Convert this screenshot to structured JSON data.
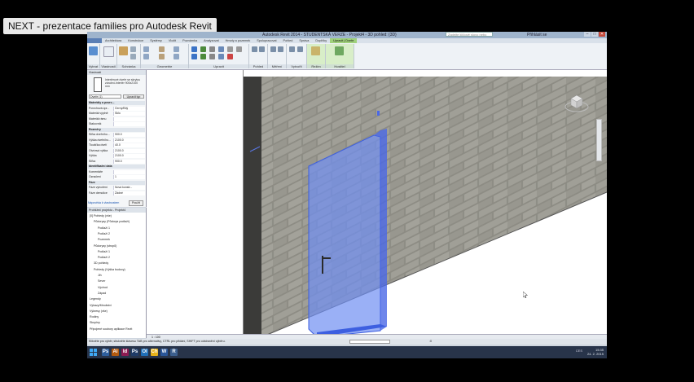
{
  "video_title": "NEXT - prezentace families pro Autodesk Revit",
  "window": {
    "app_title": "Autodesk Revit 2014 - STUDENTSKÁ VERZE - Projekt4 - 3D pohled: {3D}",
    "search_placeholder": "Zadejte klíčové slovo nebo frázi",
    "login": "Přihlásit se",
    "controls": [
      "–",
      "□",
      "✕"
    ]
  },
  "ribbon": {
    "tabs": [
      "Architektura",
      "Konstrukce",
      "Systémy",
      "Vložit",
      "Poznámka",
      "Analyzovat",
      "Hmoty a pozemek",
      "Spolupracovat",
      "Pohled",
      "Správa",
      "Doplňky",
      "Upravit | Dveře"
    ],
    "active_tab": "Upravit | Dveře",
    "panels": [
      "Vybrat",
      "Vlastnosti",
      "Schránka",
      "Geometrie",
      "Upravit",
      "Pohled",
      "Měření",
      "Vytvořit",
      "Režim",
      "Hostitel"
    ],
    "buttons": {
      "modify": "Upravit",
      "flip": "Upravit rodinu",
      "pick_host": "Vybrat novou hostitele"
    }
  },
  "properties": {
    "title": "Vlastnosti",
    "type_name": "Interiérové dveře se skrytou zárubní-Interiér 900x2100 mm",
    "selector": "Dveře (1)",
    "edit_type": "Upravit typ",
    "rows": [
      {
        "k": "Materiály a povrc...",
        "v": "",
        "group": true
      },
      {
        "k": "Povrchová úpr...",
        "v": "Černý/Bílý",
        "group": false
      },
      {
        "k": "Materiál výplně",
        "v": "Sklo",
        "group": false
      },
      {
        "k": "Materiál rámu",
        "v": "",
        "group": false
      },
      {
        "k": "Stakovník",
        "v": "",
        "group": false
      },
      {
        "k": "Rozměry",
        "v": "",
        "group": true
      },
      {
        "k": "Šířka dveřního...",
        "v": "900.0",
        "group": false
      },
      {
        "k": "Výška dveřního...",
        "v": "2100.0",
        "group": false
      },
      {
        "k": "Tloušťka dveří",
        "v": "40.0",
        "group": false
      },
      {
        "k": "Otvíravá výška",
        "v": "2100.0",
        "group": false
      },
      {
        "k": "Výška",
        "v": "2100.0",
        "group": false
      },
      {
        "k": "Šířka",
        "v": "900.0",
        "group": false
      },
      {
        "k": "Identifikační data",
        "v": "",
        "group": true
      },
      {
        "k": "Komentáře",
        "v": "",
        "group": false
      },
      {
        "k": "Označení",
        "v": "1",
        "group": false
      },
      {
        "k": "Fáze",
        "v": "",
        "group": true
      },
      {
        "k": "Fáze vytvoření",
        "v": "Nová konstr...",
        "group": false
      },
      {
        "k": "Fáze demolice",
        "v": "Žádné",
        "group": false
      }
    ],
    "help_link": "Nápověda k vlastnostem",
    "apply": "Použít"
  },
  "browser": {
    "title": "Prohlížeč projektu - Projekt4",
    "items": [
      {
        "label": "[0] Pohledy (vše)",
        "indent": 0
      },
      {
        "label": "Půdorysy (Půdorys podlaží)",
        "indent": 1
      },
      {
        "label": "Podlaží 1",
        "indent": 2
      },
      {
        "label": "Podlaží 2",
        "indent": 2
      },
      {
        "label": "Pozemek",
        "indent": 2
      },
      {
        "label": "Půdorysy (stropů)",
        "indent": 1
      },
      {
        "label": "Podlaží 1",
        "indent": 2
      },
      {
        "label": "Podlaží 2",
        "indent": 2
      },
      {
        "label": "3D pohledy",
        "indent": 1
      },
      {
        "label": "Pohledy (Výška budovy)",
        "indent": 1
      },
      {
        "label": "Jih",
        "indent": 2
      },
      {
        "label": "Sever",
        "indent": 2
      },
      {
        "label": "Východ",
        "indent": 2
      },
      {
        "label": "Západ",
        "indent": 2
      },
      {
        "label": "Legendy",
        "indent": 0
      },
      {
        "label": "Výkazy/Množství",
        "indent": 0
      },
      {
        "label": "Výkresy (vše)",
        "indent": 0
      },
      {
        "label": "Rodiny",
        "indent": 0
      },
      {
        "label": "Skupiny",
        "indent": 0
      },
      {
        "label": "Připojené soubory aplikace Revit",
        "indent": 0
      }
    ]
  },
  "view_controls": {
    "scale": "1 : 100"
  },
  "status": {
    "hint": "Klikněte pro výběr, stiskněte klávesu TAB pro alternativy, CTRL pro přidání, SHIFT pro odstranění výběru.",
    "count": ":0"
  },
  "taskbar": {
    "apps": [
      "Ps",
      "Ai",
      "Id",
      "Ps",
      "Ol",
      "Ch",
      "W",
      "R"
    ],
    "lang": "CES",
    "time": "15:35",
    "date": "24. 2. 2015"
  },
  "colors": {
    "door_glass": "#6f8ff2",
    "selection_blue": "#4a68e6",
    "wall_block": "#8f8e86",
    "ribbon_active": "#9fd17b"
  }
}
